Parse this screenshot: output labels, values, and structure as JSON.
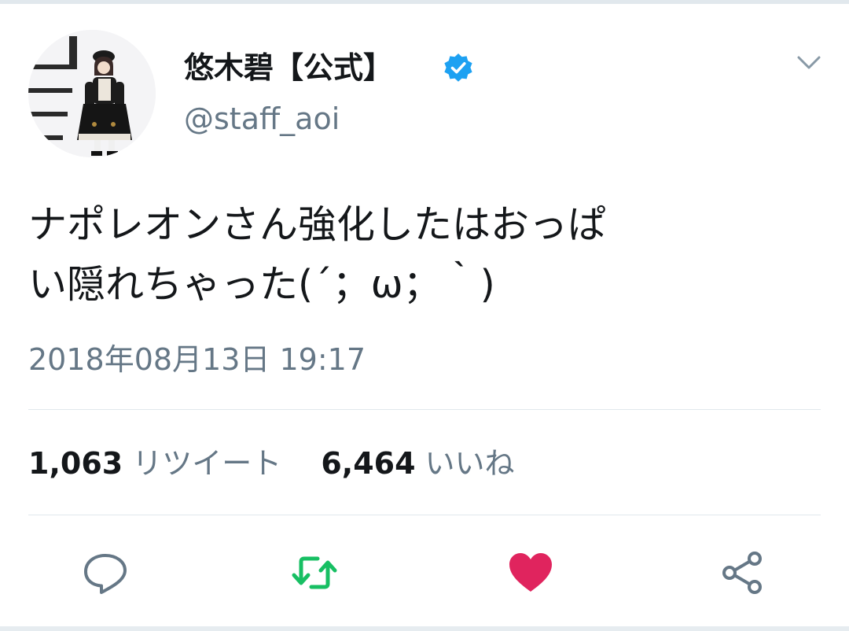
{
  "tweet": {
    "display_name": "悠木碧【公式】",
    "handle": "@staff_aoi",
    "verified": true,
    "text_line1": "ナポレオンさん強化したはおっぱ",
    "text_line2": "い隠れちゃった(´；ω；｀)",
    "timestamp": "2018年08月13日 19:17"
  },
  "stats": {
    "retweet_count": "1,063",
    "retweet_label": "リツイート",
    "like_count": "6,464",
    "like_label": "いいね"
  },
  "actions": [
    {
      "name": "reply",
      "icon": "speech-bubble-icon"
    },
    {
      "name": "retweet",
      "icon": "retweet-arrows-icon"
    },
    {
      "name": "like",
      "icon": "heart-icon"
    },
    {
      "name": "share",
      "icon": "share-nodes-icon"
    }
  ],
  "colors": {
    "text": "#14171a",
    "secondary_text": "#657786",
    "verified_blue": "#1da1f2",
    "retweet_green": "#17bf63",
    "like_red": "#e0245e",
    "icon_gray": "#657786",
    "divider": "#e1e8ed"
  }
}
